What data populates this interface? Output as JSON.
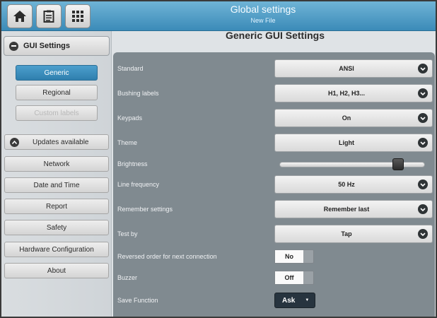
{
  "topbar": {
    "title": "Global settings",
    "subtitle": "New File",
    "icons": [
      "home-icon",
      "clipboard-icon",
      "keypad-grid-icon"
    ]
  },
  "sidebar": {
    "header": "GUI Settings",
    "sub_items": [
      {
        "label": "Generic",
        "state": "active"
      },
      {
        "label": "Regional",
        "state": "normal"
      },
      {
        "label": "Custom labels",
        "state": "disabled"
      }
    ],
    "updates": "Updates available",
    "items": [
      {
        "label": "Network"
      },
      {
        "label": "Date and Time"
      },
      {
        "label": "Report"
      },
      {
        "label": "Safety"
      },
      {
        "label": "Hardware Configuration"
      },
      {
        "label": "About"
      }
    ]
  },
  "content": {
    "title": "Generic GUI Settings",
    "rows": {
      "standard": {
        "label": "Standard",
        "value": "ANSI"
      },
      "bushing_labels": {
        "label": "Bushing labels",
        "value": "H1, H2, H3..."
      },
      "keypads": {
        "label": "Keypads",
        "value": "On"
      },
      "theme": {
        "label": "Theme",
        "value": "Light"
      },
      "brightness": {
        "label": "Brightness",
        "level_fraction": 0.84
      },
      "line_frequency": {
        "label": "Line frequency",
        "value": "50 Hz"
      },
      "remember_settings": {
        "label": "Remember settings",
        "value": "Remember last"
      },
      "test_by": {
        "label": "Test by",
        "value": "Tap"
      },
      "reversed_order": {
        "label": "Reversed order for next connection",
        "value": "No"
      },
      "buzzer": {
        "label": "Buzzer",
        "value": "Off"
      },
      "save_function": {
        "label": "Save Function",
        "value": "Ask"
      }
    }
  },
  "colors": {
    "accent": "#3b8bb8",
    "panel": "#808a90",
    "active_item": "#4c9fcd"
  }
}
